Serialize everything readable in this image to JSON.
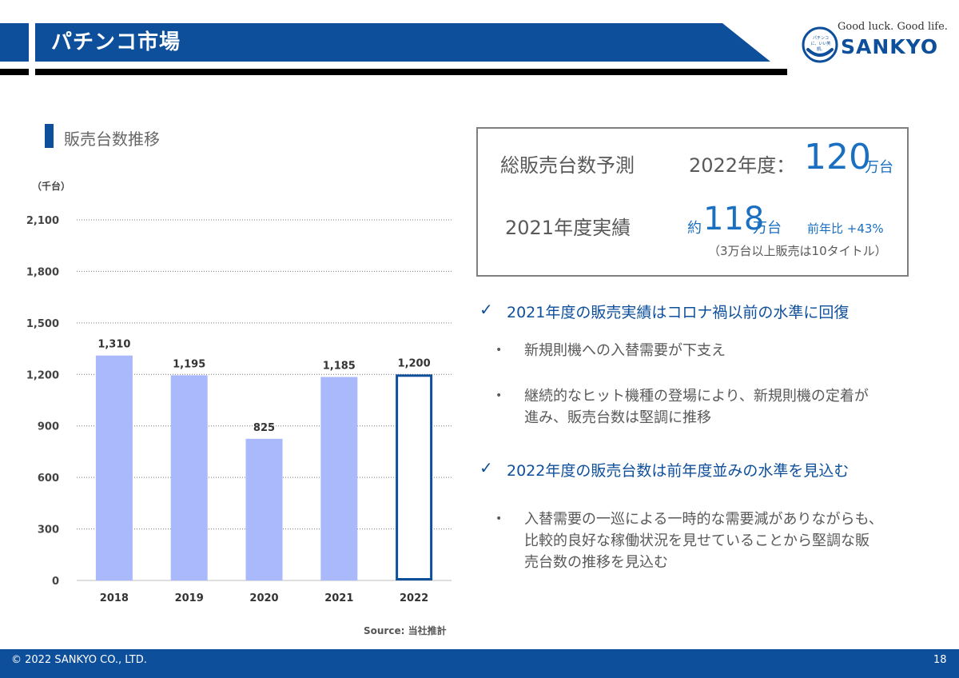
{
  "header": {
    "title": "パチンコ市場"
  },
  "logo": {
    "tagline": "Good luck. Good life.",
    "wordmark": "SANKYO",
    "emblem": "パチンコに、いい笑顔。"
  },
  "section": {
    "title": "販売台数推移"
  },
  "chart_data": {
    "type": "bar",
    "unit_label": "（千台）",
    "categories": [
      "2018",
      "2019",
      "2020",
      "2021",
      "2022"
    ],
    "values": [
      1310,
      1195,
      825,
      1185,
      1200
    ],
    "value_labels": [
      "1,310",
      "1,195",
      "825",
      "1,185",
      "1,200"
    ],
    "forecast_index": 4,
    "ylim": [
      0,
      2100
    ],
    "yticks": [
      0,
      300,
      600,
      900,
      1200,
      1500,
      1800,
      2100
    ],
    "ytick_labels": [
      "0",
      "300",
      "600",
      "900",
      "1,200",
      "1,500",
      "1,800",
      "2,100"
    ],
    "grid": true,
    "bar_color": "#a9b9fb",
    "forecast_border_color": "#0e4f9c"
  },
  "source": "Source: 当社推計",
  "forecast": {
    "label": "総販売台数予測",
    "year": "2022年度：",
    "value": "120",
    "unit": "万台",
    "actual_label": "2021年度実績",
    "approx": "約",
    "actual_value": "118",
    "actual_unit": "万台",
    "yoy": "前年比 +43%",
    "note": "（3万台以上販売は10タイトル）"
  },
  "points": [
    {
      "check": "✓",
      "heading": "2021年度の販売実績はコロナ禍以前の水準に回復",
      "bullets": [
        [
          "新規則機への入替需要が下支え"
        ],
        [
          "継続的なヒット機種の登場により、新規則機の定着が",
          "進み、販売台数は堅調に推移"
        ]
      ]
    },
    {
      "check": "✓",
      "heading": "2022年度の販売台数は前年度並みの水準を見込む",
      "bullets": [
        [
          "入替需要の一巡による一時的な需要減がありながらも、",
          "比較的良好な稼働状況を見せていることから堅調な販",
          "売台数の推移を見込む"
        ]
      ]
    }
  ],
  "footer": {
    "copyright": "© 2022 SANKYO CO., LTD.",
    "page": "18"
  },
  "colors": {
    "brand": "#0e4f9c",
    "accent": "#1a6fc1"
  }
}
